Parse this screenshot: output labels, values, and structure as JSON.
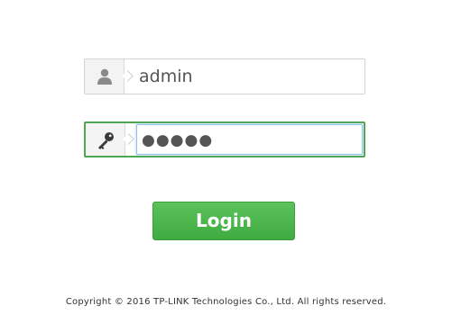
{
  "login": {
    "username_value": "admin",
    "username_icon": "user-icon",
    "password_masked": "●●●●●",
    "password_icon": "key-icon",
    "button_label": "Login",
    "button_color": "#4cb84c",
    "focus_border_color": "#4fa84f"
  },
  "footer": {
    "copyright": "Copyright © 2016 TP-LINK Technologies Co., Ltd. All rights reserved."
  }
}
